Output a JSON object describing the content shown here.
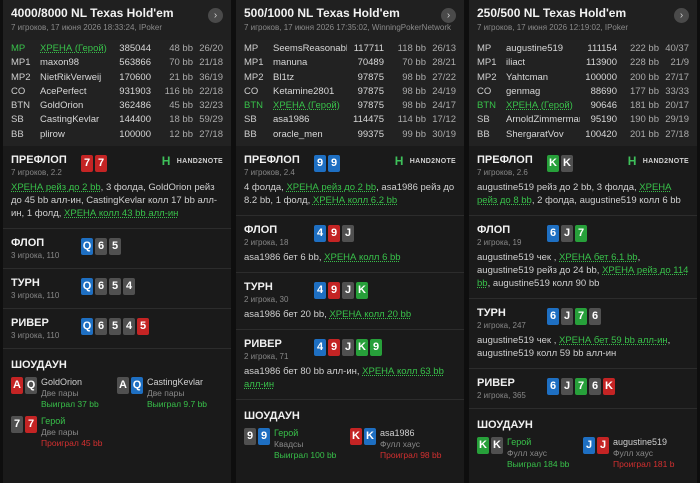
{
  "hands": [
    {
      "title": "4000/8000 NL Texas Hold'em",
      "subtitle": "7 игроков, 17 июня 2026 18:33:24, IPoker",
      "arrow": "›",
      "players": [
        {
          "pos": "MP",
          "name": "ХРЕНА (Герой)",
          "stack": "385044",
          "bb": "48 bb",
          "count": "26/20",
          "hero": true
        },
        {
          "pos": "MP1",
          "name": "maxon98",
          "stack": "563866",
          "bb": "70 bb",
          "count": "21/18"
        },
        {
          "pos": "MP2",
          "name": "NietRikVerweij",
          "stack": "170600",
          "bb": "21 bb",
          "count": "36/19"
        },
        {
          "pos": "CO",
          "name": "AcePerfect",
          "stack": "931903",
          "bb": "116 bb",
          "count": "22/18"
        },
        {
          "pos": "BTN",
          "name": "GoldOrion",
          "stack": "362486",
          "bb": "45 bb",
          "count": "32/23"
        },
        {
          "pos": "SB",
          "name": "CastingKevlar",
          "stack": "144400",
          "bb": "18 bb",
          "count": "59/29"
        },
        {
          "pos": "BB",
          "name": "plirow",
          "stack": "100000",
          "bb": "12 bb",
          "count": "27/18"
        }
      ],
      "streets": [
        {
          "label": "ПРЕФЛОП",
          "meta": "7 игроков, 2.2",
          "cards": [
            {
              "r": "7",
              "c": "r"
            },
            {
              "r": "7",
              "c": "r"
            }
          ],
          "logo": true,
          "action": [
            [
              "ХРЕНА рейз до 2 bb",
              true
            ],
            [
              ", 3 фолда, GoldOrion рейз до 45 bb алл-ин, CastingKevlar колл 17 bb алл-ин, 1 фолд, ",
              false
            ],
            [
              "ХРЕНА колл 43 bb алл-ин",
              true
            ]
          ]
        },
        {
          "label": "ФЛОП",
          "meta": "3 игрока, 110",
          "cards": [
            {
              "r": "Q",
              "c": "b"
            },
            {
              "r": "6",
              "c": "k"
            },
            {
              "r": "5",
              "c": "k"
            }
          ]
        },
        {
          "label": "ТУРН",
          "meta": "3 игрока, 110",
          "cards": [
            {
              "r": "Q",
              "c": "b"
            },
            {
              "r": "6",
              "c": "k"
            },
            {
              "r": "5",
              "c": "k"
            },
            {
              "r": "4",
              "c": "k"
            }
          ]
        },
        {
          "label": "РИВЕР",
          "meta": "3 игрока, 110",
          "cards": [
            {
              "r": "Q",
              "c": "b"
            },
            {
              "r": "6",
              "c": "k"
            },
            {
              "r": "5",
              "c": "k"
            },
            {
              "r": "4",
              "c": "k"
            },
            {
              "r": "5",
              "c": "r"
            }
          ]
        }
      ],
      "showdown_title": "ШОУДАУН",
      "showdown": [
        {
          "cards": [
            {
              "r": "A",
              "c": "r"
            },
            {
              "r": "Q",
              "c": "k"
            }
          ],
          "name": "GoldOrion",
          "hand": "Две пары",
          "result": "Выиграл 37 bb",
          "win": true
        },
        {
          "cards": [
            {
              "r": "A",
              "c": "k"
            },
            {
              "r": "Q",
              "c": "b"
            }
          ],
          "name": "CastingKevlar",
          "hand": "Две пары",
          "result": "Выиграл 9.7 bb",
          "win": true
        },
        {
          "cards": [
            {
              "r": "7",
              "c": "k"
            },
            {
              "r": "7",
              "c": "r"
            }
          ],
          "name": "Герой",
          "hero": true,
          "hand": "Две пары",
          "result": "Проиграл 45 bb",
          "win": false
        }
      ]
    },
    {
      "title": "500/1000 NL Texas Hold'em",
      "subtitle": "7 игроков, 17 июня 2026 17:35:02, WinningPokerNetwork",
      "arrow": "›",
      "players": [
        {
          "pos": "MP",
          "name": "SeemsReasonable",
          "stack": "117711",
          "bb": "118 bb",
          "count": "26/13"
        },
        {
          "pos": "MP1",
          "name": "manuna",
          "stack": "70489",
          "bb": "70 bb",
          "count": "28/21"
        },
        {
          "pos": "MP2",
          "name": "Bl1tz",
          "stack": "97875",
          "bb": "98 bb",
          "count": "27/22"
        },
        {
          "pos": "CO",
          "name": "Ketamine2801",
          "stack": "97875",
          "bb": "98 bb",
          "count": "24/19"
        },
        {
          "pos": "BTN",
          "name": "ХРЕНА (Герой)",
          "stack": "97875",
          "bb": "98 bb",
          "count": "24/17",
          "hero": true
        },
        {
          "pos": "SB",
          "name": "asa1986",
          "stack": "114475",
          "bb": "114 bb",
          "count": "17/12"
        },
        {
          "pos": "BB",
          "name": "oracle_men",
          "stack": "99375",
          "bb": "99 bb",
          "count": "30/19"
        }
      ],
      "streets": [
        {
          "label": "ПРЕФЛОП",
          "meta": "7 игроков, 2.4",
          "cards": [
            {
              "r": "9",
              "c": "b"
            },
            {
              "r": "9",
              "c": "b"
            }
          ],
          "logo": true,
          "action": [
            [
              "4 фолда, ",
              false
            ],
            [
              "ХРЕНА рейз до 2 bb",
              true
            ],
            [
              ", asa1986 рейз до 8.2 bb, 1 фолд, ",
              false
            ],
            [
              "ХРЕНА колл 6.2 bb",
              true
            ]
          ]
        },
        {
          "label": "ФЛОП",
          "meta": "2 игрока, 18",
          "cards": [
            {
              "r": "4",
              "c": "b"
            },
            {
              "r": "9",
              "c": "r"
            },
            {
              "r": "J",
              "c": "k"
            }
          ],
          "action": [
            [
              "asa1986 бет 6 bb, ",
              false
            ],
            [
              "ХРЕНА колл 6 bb",
              true
            ]
          ]
        },
        {
          "label": "ТУРН",
          "meta": "2 игрока, 30",
          "cards": [
            {
              "r": "4",
              "c": "b"
            },
            {
              "r": "9",
              "c": "r"
            },
            {
              "r": "J",
              "c": "k"
            },
            {
              "r": "K",
              "c": "g"
            }
          ],
          "action": [
            [
              "asa1986 бет 20 bb, ",
              false
            ],
            [
              "ХРЕНА колл 20 bb",
              true
            ]
          ]
        },
        {
          "label": "РИВЕР",
          "meta": "2 игрока, 71",
          "cards": [
            {
              "r": "4",
              "c": "b"
            },
            {
              "r": "9",
              "c": "r"
            },
            {
              "r": "J",
              "c": "k"
            },
            {
              "r": "K",
              "c": "g"
            },
            {
              "r": "9",
              "c": "g"
            }
          ],
          "action": [
            [
              "asa1986 бет 80 bb алл-ин, ",
              false
            ],
            [
              "ХРЕНА колл 63 bb алл-ин",
              true
            ]
          ]
        }
      ],
      "showdown_title": "ШОУДАУН",
      "showdown": [
        {
          "cards": [
            {
              "r": "9",
              "c": "k"
            },
            {
              "r": "9",
              "c": "b"
            }
          ],
          "name": "Герой",
          "hero": true,
          "hand": "Квадсы",
          "result": "Выиграл 100 bb",
          "win": true
        },
        {
          "cards": [
            {
              "r": "K",
              "c": "r"
            },
            {
              "r": "K",
              "c": "b"
            }
          ],
          "name": "asa1986",
          "hand": "Фулл хаус",
          "result": "Проиграл 98 bb",
          "win": false
        }
      ]
    },
    {
      "title": "250/500 NL Texas Hold'em",
      "subtitle": "7 игроков, 17 июня 2026 12:19:02, IPoker",
      "arrow": "›",
      "players": [
        {
          "pos": "MP",
          "name": "augustine519",
          "stack": "111154",
          "bb": "222 bb",
          "count": "40/37"
        },
        {
          "pos": "MP1",
          "name": "iliact",
          "stack": "113900",
          "bb": "228 bb",
          "count": "21/9"
        },
        {
          "pos": "MP2",
          "name": "Yahtcman",
          "stack": "100000",
          "bb": "200 bb",
          "count": "27/17"
        },
        {
          "pos": "CO",
          "name": "genmag",
          "stack": "88690",
          "bb": "177 bb",
          "count": "33/33"
        },
        {
          "pos": "BTN",
          "name": "ХРЕНА (Герой)",
          "stack": "90646",
          "bb": "181 bb",
          "count": "20/17",
          "hero": true
        },
        {
          "pos": "SB",
          "name": "ArnoldZimmerman",
          "stack": "95190",
          "bb": "190 bb",
          "count": "29/19"
        },
        {
          "pos": "BB",
          "name": "ShergaratVov",
          "stack": "100420",
          "bb": "201 bb",
          "count": "27/18"
        }
      ],
      "streets": [
        {
          "label": "ПРЕФЛОП",
          "meta": "7 игроков, 2.6",
          "cards": [
            {
              "r": "K",
              "c": "g"
            },
            {
              "r": "K",
              "c": "k"
            }
          ],
          "logo": true,
          "action": [
            [
              "augustine519 рейз до 2 bb, 3 фолда, ",
              false
            ],
            [
              "ХРЕНА рейз до 8 bb",
              true
            ],
            [
              ", 2 фолда, augustine519 колл 6 bb",
              false
            ]
          ]
        },
        {
          "label": "ФЛОП",
          "meta": "2 игрока, 19",
          "cards": [
            {
              "r": "6",
              "c": "b"
            },
            {
              "r": "J",
              "c": "k"
            },
            {
              "r": "7",
              "c": "g"
            }
          ],
          "action": [
            [
              "augustine519 чек , ",
              false
            ],
            [
              "ХРЕНА бет 6.1 bb",
              true
            ],
            [
              ", augustine519 рейз до 24 bb, ",
              false
            ],
            [
              "ХРЕНА рейз до 114 bb",
              true
            ],
            [
              ", augustine519 колл 90 bb",
              false
            ]
          ]
        },
        {
          "label": "ТУРН",
          "meta": "2 игрока, 247",
          "cards": [
            {
              "r": "6",
              "c": "b"
            },
            {
              "r": "J",
              "c": "k"
            },
            {
              "r": "7",
              "c": "g"
            },
            {
              "r": "6",
              "c": "k"
            }
          ],
          "action": [
            [
              "augustine519 чек , ",
              false
            ],
            [
              "ХРЕНА бет 59 bb алл-ин",
              true
            ],
            [
              ", augustine519 колл 59 bb алл-ин",
              false
            ]
          ]
        },
        {
          "label": "РИВЕР",
          "meta": "2 игрока, 365",
          "cards": [
            {
              "r": "6",
              "c": "b"
            },
            {
              "r": "J",
              "c": "k"
            },
            {
              "r": "7",
              "c": "g"
            },
            {
              "r": "6",
              "c": "k"
            },
            {
              "r": "K",
              "c": "r"
            }
          ]
        }
      ],
      "showdown_title": "ШОУДАУН",
      "showdown": [
        {
          "cards": [
            {
              "r": "K",
              "c": "g"
            },
            {
              "r": "K",
              "c": "k"
            }
          ],
          "name": "Герой",
          "hero": true,
          "hand": "Фулл хаус",
          "result": "Выиграл 184 bb",
          "win": true
        },
        {
          "cards": [
            {
              "r": "J",
              "c": "b"
            },
            {
              "r": "J",
              "c": "r"
            }
          ],
          "name": "augustine519",
          "hand": "Фулл хаус",
          "result": "Проиграл 181 b",
          "win": false
        }
      ]
    }
  ],
  "logo_text": "HAND2NOTE",
  "logo_glyph": "H",
  "colors": {
    "hero": "#38c14a",
    "loss": "#d43030",
    "card_blue": "#1e6fc2",
    "card_red": "#c42424",
    "card_green": "#27a03a",
    "card_gray": "#505050"
  }
}
